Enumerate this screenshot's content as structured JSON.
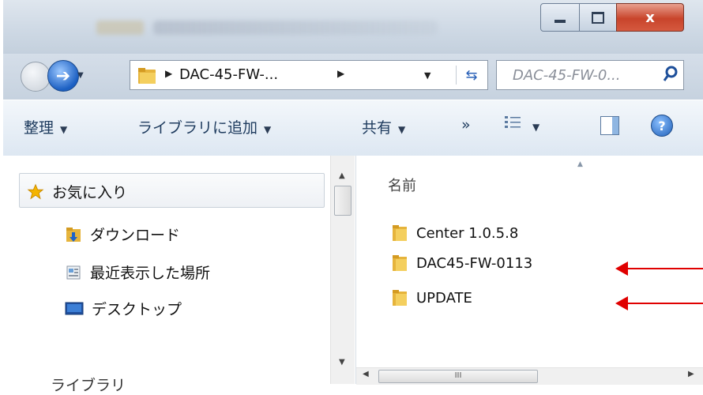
{
  "window": {
    "controls": {
      "close": "x"
    }
  },
  "nav": {
    "breadcrumb": "DAC-45-FW-...",
    "search_placeholder": "DAC-45-FW-0..."
  },
  "toolbar": {
    "organize": "整理",
    "add_to_library": "ライブラリに追加",
    "share": "共有",
    "more": "»"
  },
  "sidebar": {
    "favorites": "お気に入り",
    "items": [
      {
        "label": "ダウンロード",
        "icon": "download-folder-icon"
      },
      {
        "label": "最近表示した場所",
        "icon": "recent-places-icon"
      },
      {
        "label": "デスクトップ",
        "icon": "desktop-icon"
      }
    ],
    "library_partial": "ライブラリ"
  },
  "content": {
    "column_header": "名前",
    "files": [
      {
        "name": "Center 1.0.5.8",
        "icon": "folder-icon",
        "marked": false
      },
      {
        "name": "DAC45-FW-0113",
        "icon": "folder-icon",
        "marked": true
      },
      {
        "name": "UPDATE",
        "icon": "folder-icon",
        "marked": true
      }
    ],
    "hscroll_grip": "III"
  },
  "colors": {
    "accent": "#1e3b5e",
    "annotation_arrow": "#e00000",
    "close_button": "#c8442b"
  }
}
